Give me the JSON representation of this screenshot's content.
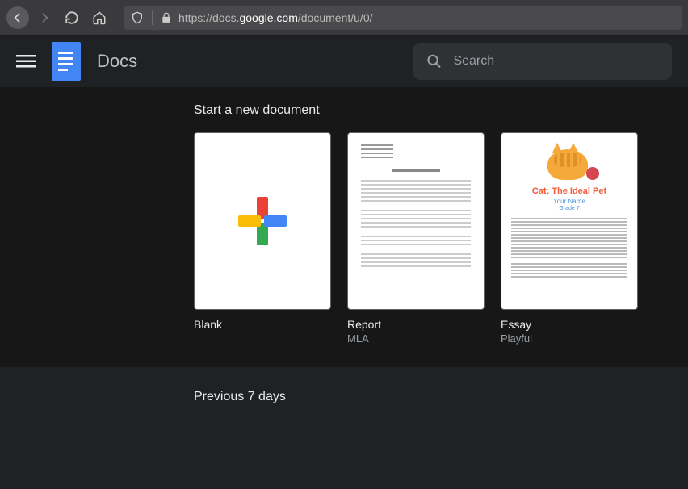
{
  "browser": {
    "url_prefix": "https://docs.",
    "url_domain": "google.com",
    "url_suffix": "/document/u/0/"
  },
  "header": {
    "app_title": "Docs",
    "search_placeholder": "Search"
  },
  "templates": {
    "section_title": "Start a new document",
    "items": [
      {
        "name": "Blank",
        "subtitle": ""
      },
      {
        "name": "Report",
        "subtitle": "MLA"
      },
      {
        "name": "Essay",
        "subtitle": "Playful"
      }
    ],
    "essay_preview": {
      "title": "Cat: The Ideal Pet",
      "subtitle": "Your Name",
      "grade": "Grade 7"
    }
  },
  "recent": {
    "section_title": "Previous 7 days"
  }
}
